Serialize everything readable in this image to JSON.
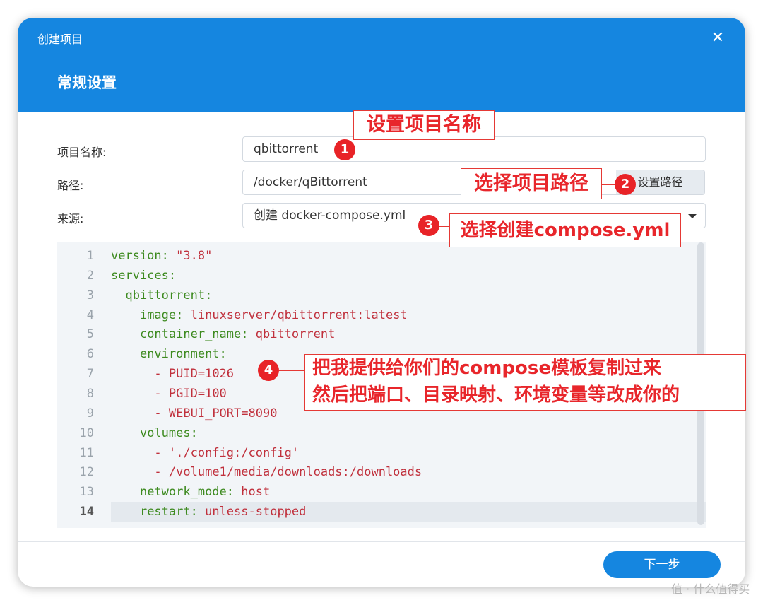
{
  "dialog": {
    "title": "创建项目",
    "close_glyph": "✕",
    "section_title": "常规设置"
  },
  "form": {
    "name_label": "项目名称:",
    "name_value": "qbittorrent",
    "path_label": "路径:",
    "path_value": "/docker/qBittorrent",
    "path_button": "设置路径",
    "source_label": "来源:",
    "source_value": "创建 docker-compose.yml"
  },
  "editor": {
    "lines": [
      {
        "num": "1",
        "indent": "",
        "key": "version",
        "sep": ": ",
        "val": "\"3.8\""
      },
      {
        "num": "2",
        "indent": "",
        "key": "services",
        "sep": ":",
        "val": ""
      },
      {
        "num": "3",
        "indent": "  ",
        "key": "qbittorrent",
        "sep": ":",
        "val": ""
      },
      {
        "num": "4",
        "indent": "    ",
        "key": "image",
        "sep": ": ",
        "val": "linuxserver/qbittorrent:latest"
      },
      {
        "num": "5",
        "indent": "    ",
        "key": "container_name",
        "sep": ": ",
        "val": "qbittorrent"
      },
      {
        "num": "6",
        "indent": "    ",
        "key": "environment",
        "sep": ":",
        "val": ""
      },
      {
        "num": "7",
        "indent": "      ",
        "key": "",
        "sep": "- ",
        "val": "PUID=1026"
      },
      {
        "num": "8",
        "indent": "      ",
        "key": "",
        "sep": "- ",
        "val": "PGID=100"
      },
      {
        "num": "9",
        "indent": "      ",
        "key": "",
        "sep": "- ",
        "val": "WEBUI_PORT=8090"
      },
      {
        "num": "10",
        "indent": "    ",
        "key": "volumes",
        "sep": ":",
        "val": ""
      },
      {
        "num": "11",
        "indent": "      ",
        "key": "",
        "sep": "- ",
        "val": "'./config:/config'"
      },
      {
        "num": "12",
        "indent": "      ",
        "key": "",
        "sep": "- ",
        "val": "/volume1/media/downloads:/downloads"
      },
      {
        "num": "13",
        "indent": "    ",
        "key": "network_mode",
        "sep": ": ",
        "val": "host"
      },
      {
        "num": "14",
        "indent": "    ",
        "key": "restart",
        "sep": ": ",
        "val": "unless-stopped"
      }
    ],
    "active_line": 14
  },
  "footer": {
    "next_button": "下一步"
  },
  "annotations": {
    "a1": {
      "num": "1",
      "text": "设置项目名称"
    },
    "a2": {
      "num": "2",
      "text": "选择项目路径"
    },
    "a3": {
      "num": "3",
      "text": "选择创建compose.yml"
    },
    "a4": {
      "num": "4",
      "line1": "把我提供给你们的compose模板复制过来",
      "line2": "然后把端口、目录映射、环境变量等改成你的"
    }
  },
  "watermark": "值 · 什么值得买",
  "colors": {
    "header_blue": "#1586e0",
    "yaml_key": "#3d8a1f",
    "yaml_value": "#c0303c",
    "annotation_red": "#e8262b"
  }
}
